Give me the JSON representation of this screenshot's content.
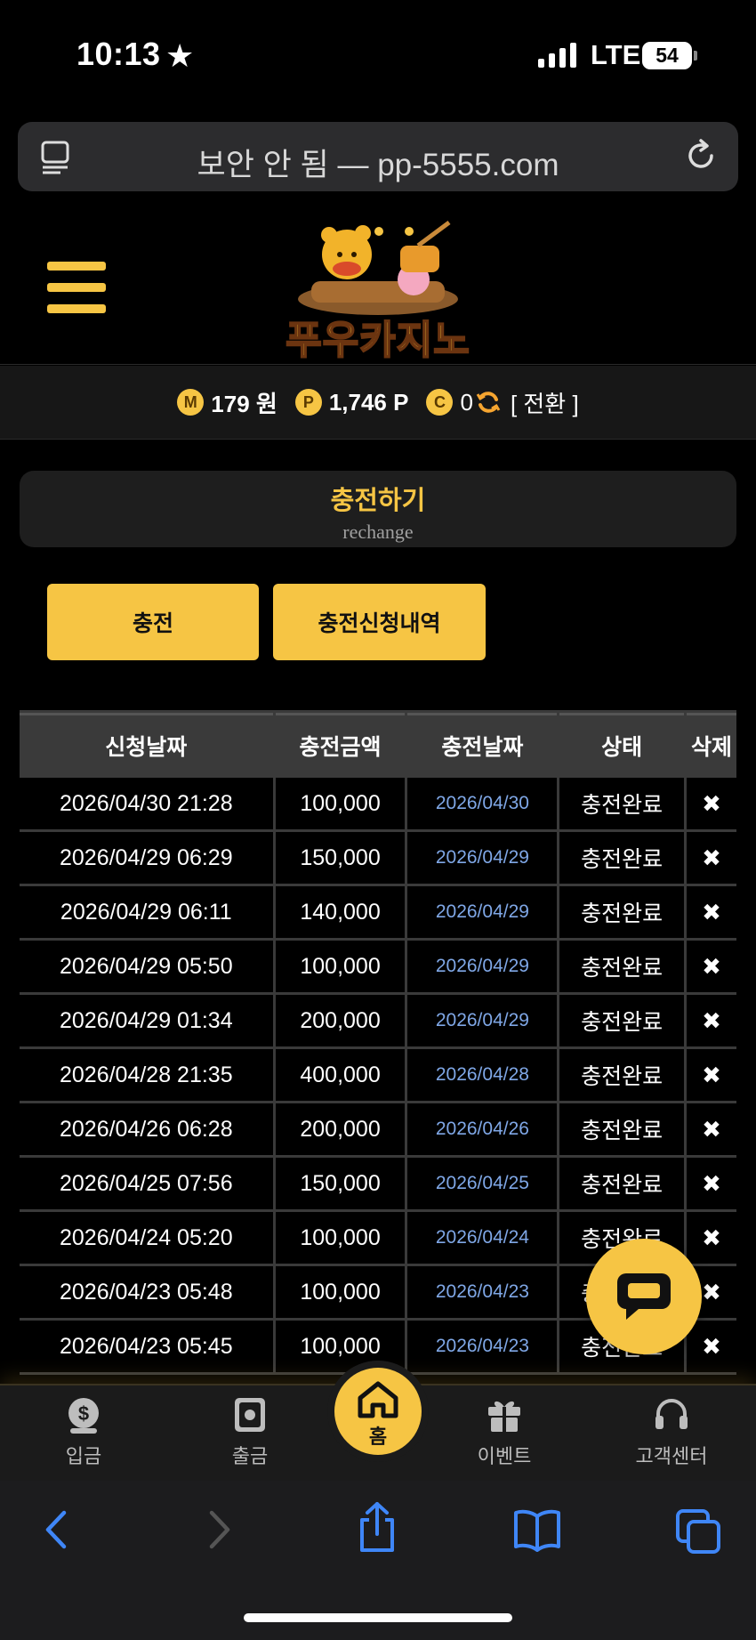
{
  "status_bar": {
    "time": "10:13",
    "star": "★",
    "network": "LTE",
    "battery": "54"
  },
  "browser": {
    "url_text": "보안 안 됨 — pp-5555.com"
  },
  "header": {
    "logo_text": "푸우카지노"
  },
  "balance": {
    "money_icon": "M",
    "money": "179 원",
    "point_icon": "P",
    "points": "1,746 P",
    "casino_icon": "C",
    "casino": "0",
    "convert_label": "[ 전환 ]"
  },
  "section": {
    "title": "충전하기",
    "subtitle": "rechange"
  },
  "buttons": {
    "charge": "충전",
    "history": "충전신청내역"
  },
  "table": {
    "headers": [
      "신청날짜",
      "충전금액",
      "충전날짜",
      "상태",
      "삭제"
    ],
    "rows": [
      {
        "req_date": "2026/04/30 21:28",
        "amount": "100,000",
        "charge_date": "2026/04/30",
        "status": "충전완료",
        "del": "✖"
      },
      {
        "req_date": "2026/04/29 06:29",
        "amount": "150,000",
        "charge_date": "2026/04/29",
        "status": "충전완료",
        "del": "✖"
      },
      {
        "req_date": "2026/04/29 06:11",
        "amount": "140,000",
        "charge_date": "2026/04/29",
        "status": "충전완료",
        "del": "✖"
      },
      {
        "req_date": "2026/04/29 05:50",
        "amount": "100,000",
        "charge_date": "2026/04/29",
        "status": "충전완료",
        "del": "✖"
      },
      {
        "req_date": "2026/04/29 01:34",
        "amount": "200,000",
        "charge_date": "2026/04/29",
        "status": "충전완료",
        "del": "✖"
      },
      {
        "req_date": "2026/04/28 21:35",
        "amount": "400,000",
        "charge_date": "2026/04/28",
        "status": "충전완료",
        "del": "✖"
      },
      {
        "req_date": "2026/04/26 06:28",
        "amount": "200,000",
        "charge_date": "2026/04/26",
        "status": "충전완료",
        "del": "✖"
      },
      {
        "req_date": "2026/04/25 07:56",
        "amount": "150,000",
        "charge_date": "2026/04/25",
        "status": "충전완료",
        "del": "✖"
      },
      {
        "req_date": "2026/04/24 05:20",
        "amount": "100,000",
        "charge_date": "2026/04/24",
        "status": "충전완료",
        "del": "✖"
      },
      {
        "req_date": "2026/04/23 05:48",
        "amount": "100,000",
        "charge_date": "2026/04/23",
        "status": "충전완료",
        "del": "✖"
      },
      {
        "req_date": "2026/04/23 05:45",
        "amount": "100,000",
        "charge_date": "2026/04/23",
        "status": "충전완료",
        "del": "✖"
      }
    ]
  },
  "bottom_nav": {
    "deposit": "입금",
    "withdraw": "출금",
    "home": "홈",
    "event": "이벤트",
    "support": "고객센터"
  },
  "colors": {
    "accent": "#f6c544",
    "background": "#000000",
    "link_date": "#7fa7e6"
  },
  "icons": {
    "browser": [
      "tab-overview-icon",
      "reload-icon"
    ],
    "header": [
      "hamburger-menu-icon",
      "logo-image"
    ],
    "nav": [
      "dollar-bag-icon",
      "safe-icon",
      "home-icon",
      "gift-icon",
      "headset-icon"
    ],
    "chat": "chat-bubble-icon",
    "safari": [
      "back-arrow-icon",
      "forward-arrow-icon",
      "share-icon",
      "bookmarks-icon",
      "tabs-icon"
    ]
  }
}
